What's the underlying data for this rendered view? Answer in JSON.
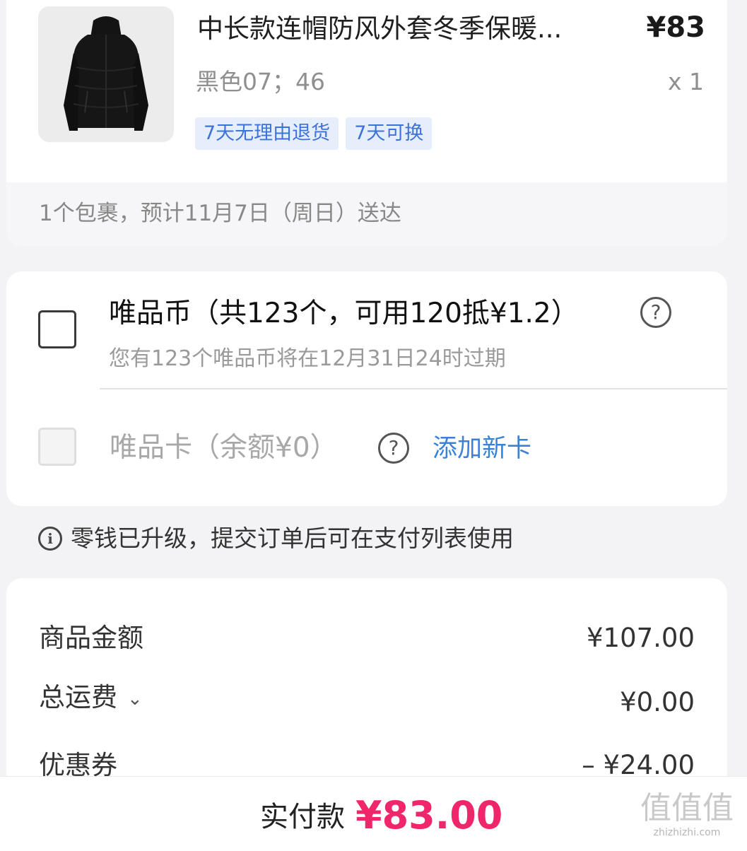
{
  "product": {
    "title": "中长款连帽防风外套冬季保暖...",
    "price": "¥83",
    "spec": "黑色07；46",
    "quantity": "x 1",
    "tags": [
      "7天无理由退货",
      "7天可换"
    ],
    "delivery": "1个包裹，预计11月7日（周日）送达"
  },
  "wallet": {
    "coin_label": "唯品币（共123个，可用120抵¥1.2）",
    "coin_expiry": "您有123个唯品币将在12月31日24时过期",
    "card_label": "唯品卡（余额¥0）",
    "add_card": "添加新卡",
    "help_icon_glyph": "?"
  },
  "notice": {
    "icon_glyph": "i",
    "text": "零钱已升级，提交订单后可在支付列表使用"
  },
  "summary": {
    "goods_label": "商品金额",
    "goods_value": "¥107.00",
    "shipping_label": "总运费",
    "shipping_value": "¥0.00",
    "coupon_label": "优惠券",
    "coupon_value": "– ¥24.00"
  },
  "footer": {
    "pay_label": "实付款",
    "pay_amount": "¥83.00"
  },
  "watermark": {
    "glyphs": "值值值",
    "url": "zhizhizhi.com"
  },
  "colors": {
    "accent_pink": "#f0266a",
    "link_blue": "#3a82d6",
    "tag_bg": "#e6eefb"
  },
  "icons": [
    "help-icon",
    "info-icon",
    "chevron-down-icon",
    "jacket-thumbnail"
  ]
}
